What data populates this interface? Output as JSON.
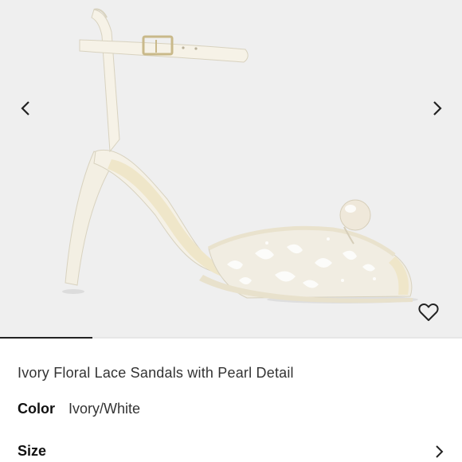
{
  "gallery": {
    "prev_icon": "chevron-left-icon",
    "next_icon": "chevron-right-icon",
    "wishlist_icon": "heart-outline-icon",
    "progress": 0.2,
    "background": "#efefef"
  },
  "product": {
    "title": "Ivory Floral Lace Sandals with Pearl Detail",
    "color_label": "Color",
    "color_value": "Ivory/White",
    "size_label": "Size",
    "size_icon": "chevron-right-icon"
  },
  "colors": {
    "text": "#333333",
    "accent": "#222222"
  }
}
